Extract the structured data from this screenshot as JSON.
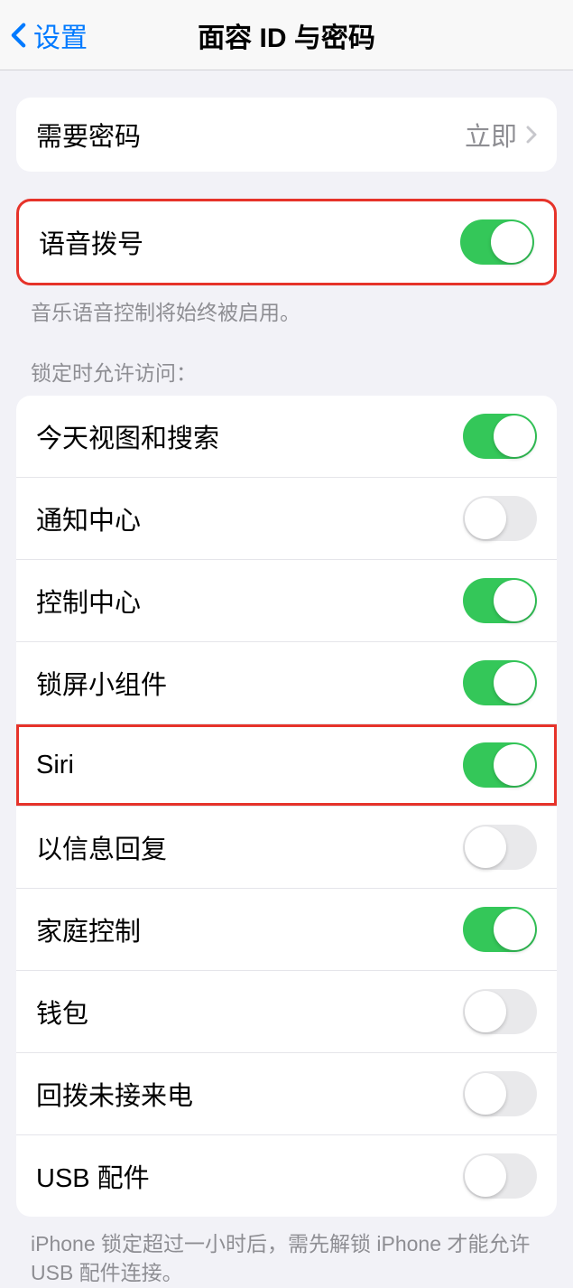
{
  "nav": {
    "back_label": "设置",
    "title": "面容 ID 与密码"
  },
  "passcode": {
    "label": "需要密码",
    "value": "立即"
  },
  "voice": {
    "label": "语音拨号",
    "on": true,
    "footer": "音乐语音控制将始终被启用。"
  },
  "locked": {
    "header": "锁定时允许访问：",
    "items": [
      {
        "label": "今天视图和搜索",
        "on": true
      },
      {
        "label": "通知中心",
        "on": false
      },
      {
        "label": "控制中心",
        "on": true
      },
      {
        "label": "锁屏小组件",
        "on": true
      },
      {
        "label": "Siri",
        "on": true,
        "highlighted": true
      },
      {
        "label": "以信息回复",
        "on": false
      },
      {
        "label": "家庭控制",
        "on": true
      },
      {
        "label": "钱包",
        "on": false
      },
      {
        "label": "回拨未接来电",
        "on": false
      },
      {
        "label": "USB 配件",
        "on": false
      }
    ],
    "footer": "iPhone 锁定超过一小时后，需先解锁 iPhone 才能允许 USB 配件连接。"
  }
}
